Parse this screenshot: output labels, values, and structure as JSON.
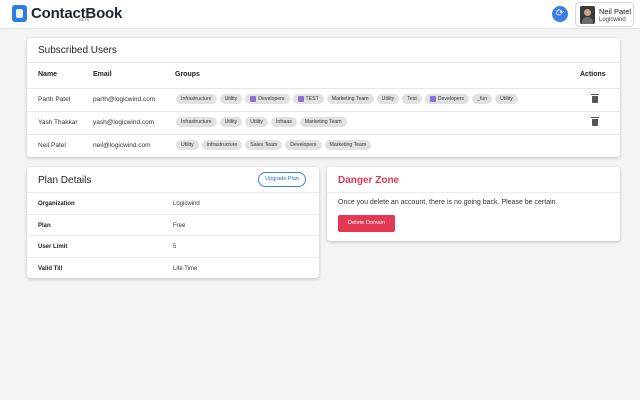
{
  "app": {
    "name": "ContactBook",
    "beta": "BETA"
  },
  "user": {
    "name": "Neil Patel",
    "org": "Logicwind"
  },
  "subscribed": {
    "title": "Subscribed Users",
    "columns": {
      "name": "Name",
      "email": "Email",
      "groups": "Groups",
      "actions": "Actions"
    },
    "rows": [
      {
        "name": "Parth Patel",
        "email": "parth@logicwind.com",
        "groups": [
          {
            "label": "Infrastructure",
            "icon": false
          },
          {
            "label": "Utility",
            "icon": false
          },
          {
            "label": "Developers",
            "icon": true
          },
          {
            "label": "TEST",
            "icon": true
          },
          {
            "label": "Marketing Team",
            "icon": false
          },
          {
            "label": "Utility",
            "icon": false
          },
          {
            "label": "Test",
            "icon": false
          },
          {
            "label": "Developers",
            "icon": true
          },
          {
            "label": "_fun",
            "icon": false
          },
          {
            "label": "Utility",
            "icon": false
          }
        ],
        "deletable": true
      },
      {
        "name": "Yash Thakkar",
        "email": "yash@logicwind.com",
        "groups": [
          {
            "label": "Infrastructure",
            "icon": false
          },
          {
            "label": "Utility",
            "icon": false
          },
          {
            "label": "Utility",
            "icon": false
          },
          {
            "label": "Infraas",
            "icon": false
          },
          {
            "label": "Marketing Team",
            "icon": false
          }
        ],
        "deletable": true
      },
      {
        "name": "Neil Patel",
        "email": "neil@logicwind.com",
        "groups": [
          {
            "label": "Utility",
            "icon": false
          },
          {
            "label": "Infrastructure",
            "icon": false
          },
          {
            "label": "Sales Team",
            "icon": false
          },
          {
            "label": "Developers",
            "icon": false
          },
          {
            "label": "Marketing Team",
            "icon": false
          }
        ],
        "deletable": false
      }
    ]
  },
  "plan": {
    "title": "Plan Details",
    "upgrade_label": "Upgrade Plan",
    "details": [
      {
        "label": "Organization",
        "value": "Logicwind"
      },
      {
        "label": "Plan",
        "value": "Free"
      },
      {
        "label": "User Limit",
        "value": "5"
      },
      {
        "label": "Valid Till",
        "value": "Life Time"
      }
    ]
  },
  "danger": {
    "title": "Danger Zone",
    "message": "Once you delete an account, there is no going back. Please be certain.",
    "button_label": "Delete Domain"
  },
  "colors": {
    "primary": "#3b7ee8",
    "danger": "#e23a53",
    "chip_bg": "#e1e1e1"
  }
}
